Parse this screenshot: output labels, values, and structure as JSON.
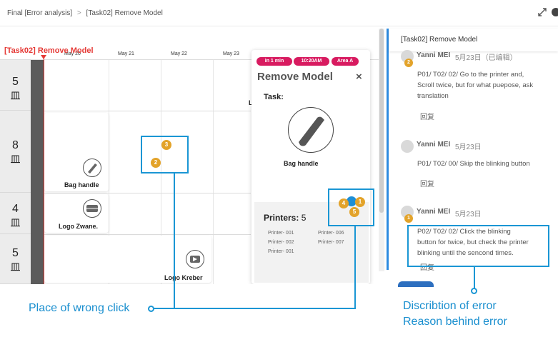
{
  "breadcrumb": {
    "parent": "Final [Error analysis]",
    "separator": ">",
    "current": "[Task02] Remove Model"
  },
  "schedule": {
    "task_label": "[Task02] Remove Model",
    "dates": [
      "May 20",
      "May 21",
      "May 22",
      "May 23"
    ],
    "rows": [
      {
        "num": "5",
        "unit": "皿"
      },
      {
        "num": "8",
        "unit": "皿"
      },
      {
        "num": "4",
        "unit": "皿"
      },
      {
        "num": "5",
        "unit": "皿"
      }
    ],
    "items": [
      {
        "label": "Bag handle",
        "icon": "bag-handle-icon"
      },
      {
        "label": "Logo Zwane.",
        "icon": "logo-zwane-icon"
      },
      {
        "label": "Logo Kreber",
        "icon": "logo-kreber-icon"
      }
    ],
    "partial_letter": "L"
  },
  "popup": {
    "tags": [
      "in 1 min",
      "10:20AM",
      "Area A"
    ],
    "title": "Remove Model",
    "close": "×",
    "task_heading": "Task:",
    "task_item": "Bag handle",
    "printers_heading": "Printers:",
    "printers_count": "5",
    "printers": [
      "Printer- 001",
      "Printer- 002",
      "Printer- 001",
      "Printer- 006",
      "Printer- 007"
    ]
  },
  "badges": {
    "a": "3",
    "b": "2",
    "c": "4",
    "d": "1",
    "e": "5"
  },
  "comments_panel": {
    "title": "[Task02] Remove Model",
    "comments": [
      {
        "author": "Yanni MEI",
        "date": "5月23日（已编辑）",
        "badge": "2",
        "text": [
          "P01/ T02/ 02/ Go to the printer and,",
          "Scroll twice, but for what puepose, ask",
          "translation"
        ],
        "reply": "回复"
      },
      {
        "author": "Yanni MEI",
        "date": "5月23日",
        "text": [
          "P01/ T02/ 00/ Skip the blinking button"
        ],
        "reply": "回复"
      },
      {
        "author": "Yanni MEI",
        "date": "5月23日",
        "badge": "1",
        "text": [
          "P02/ T02/ 02/ Click the blinking",
          "button for twice, but check the printer",
          "blinking until the sencond times."
        ],
        "reply": "回复"
      }
    ]
  },
  "annotations": {
    "wrong_click": "Place of wrong click",
    "description_line1": "Discribtion of  error",
    "description_line2": "Reason behind error"
  },
  "colors": {
    "accent": "#1a96d4",
    "tag": "#d81b60",
    "badge": "#e3a32a",
    "task_red": "#e53935"
  },
  "icons": [
    "expand-icon",
    "info-icon",
    "close-icon",
    "avatar-icon"
  ]
}
